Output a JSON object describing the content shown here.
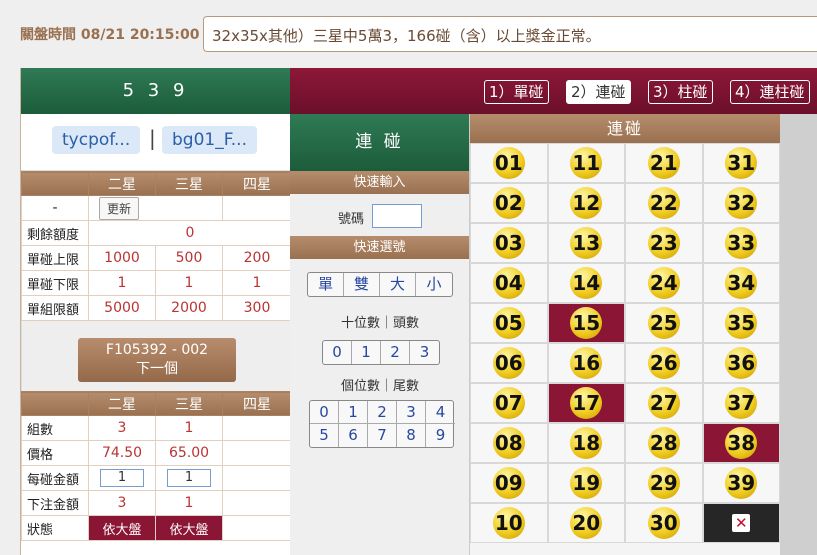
{
  "header": {
    "close_time_label": "關盤時間 08/21 20:15:00",
    "marquee": "32x35x其他）三星中5萬3，166碰（含）以上獎金正常。"
  },
  "left": {
    "game_title": "5 3 9",
    "users": [
      "tycpof...",
      "bg01_F..."
    ],
    "user_sep": "|",
    "limits_header": [
      "",
      "二星",
      "三星",
      "四星"
    ],
    "update_row_label": "-",
    "update_button": "更新",
    "rows": [
      {
        "label": "剩餘額度",
        "values": [
          "0"
        ]
      },
      {
        "label": "單碰上限",
        "values": [
          "1000",
          "500",
          "200"
        ]
      },
      {
        "label": "單碰下限",
        "values": [
          "1",
          "1",
          "1"
        ]
      },
      {
        "label": "單組限額",
        "values": [
          "5000",
          "2000",
          "300"
        ]
      }
    ],
    "next_button": {
      "line1": "F105392 - 002",
      "line2": "下一個"
    },
    "bet_header": [
      "",
      "二星",
      "三星",
      "四星"
    ],
    "bet_rows": {
      "groups": {
        "label": "組數",
        "values": [
          "3",
          "1",
          ""
        ]
      },
      "price": {
        "label": "價格",
        "values": [
          "74.50",
          "65.00",
          ""
        ]
      },
      "per_amount": {
        "label": "每碰金額",
        "values": [
          "1",
          "1",
          ""
        ]
      },
      "total": {
        "label": "下注金額",
        "values": [
          "3",
          "1",
          ""
        ]
      },
      "status": {
        "label": "狀態",
        "values": [
          "依大盤",
          "依大盤",
          ""
        ]
      }
    }
  },
  "play_types": [
    "1）單碰",
    "2）連碰",
    "3）柱碰",
    "4）連柱碰"
  ],
  "active_type_index": 1,
  "middle": {
    "title": "連 碰",
    "quick_input": "快速輸入",
    "number_label": "號碼",
    "quick_select": "快速選號",
    "quick_buttons": [
      "單",
      "雙",
      "大",
      "小"
    ],
    "tens_label": "十位數｜頭數",
    "tens_digits": [
      "0",
      "1",
      "2",
      "3"
    ],
    "units_label": "個位數｜尾數",
    "units_digits": [
      "0",
      "1",
      "2",
      "3",
      "4",
      "5",
      "6",
      "7",
      "8",
      "9"
    ]
  },
  "balls": {
    "title": "連碰",
    "numbers": [
      "01",
      "11",
      "21",
      "31",
      "02",
      "12",
      "22",
      "32",
      "03",
      "13",
      "23",
      "33",
      "04",
      "14",
      "24",
      "34",
      "05",
      "15",
      "25",
      "35",
      "06",
      "16",
      "26",
      "36",
      "07",
      "17",
      "27",
      "37",
      "08",
      "18",
      "28",
      "38",
      "09",
      "19",
      "29",
      "39",
      "10",
      "20",
      "30"
    ],
    "selected": [
      "15",
      "17",
      "38"
    ],
    "clear_icon": "close-icon",
    "selected_color": "#8b1535"
  }
}
